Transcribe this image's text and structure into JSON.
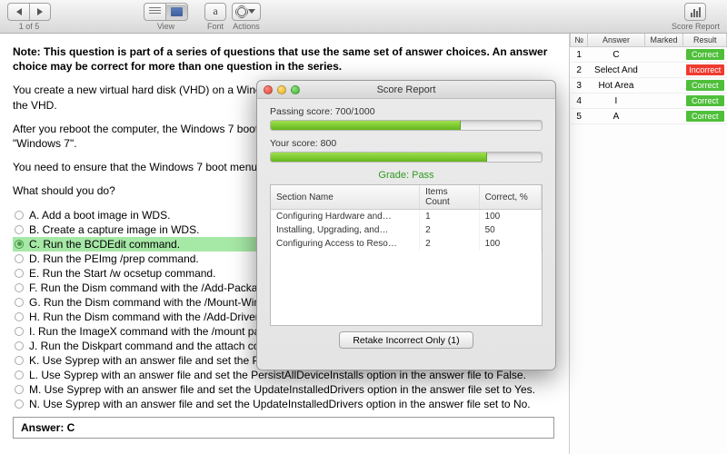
{
  "toolbar": {
    "nav_counter": "1 of 5",
    "view": "View",
    "font": "Font",
    "font_letter": "a",
    "actions": "Actions",
    "score_report": "Score Report"
  },
  "question": {
    "note": "Note: This question is part of a series of questions that use the same set of answer choices. An answer choice may be correct for more than one question in the series.",
    "para1": "You create a new virtual hard disk (VHD) on a Windows 7 Enterprise computer. Then you install Windows 7 on the VHD.",
    "para2": "After you reboot the computer, the Windows 7 boot menu shows two different Windows 7 installations titled \"Windows 7\".",
    "para3": "You need to ensure that the Windows 7 boot menu differentiates between the two Windows 7 installations.",
    "prompt": "What should you do?",
    "options": [
      "A. Add a boot image in WDS.",
      "B. Create a capture image in WDS.",
      "C. Run the BCDEdit command.",
      "D. Run the PEImg /prep command.",
      "E. Run the Start /w ocsetup command.",
      "F. Run the Dism command with the /Add-Package option.",
      "G. Run the Dism command with the /Mount-Wim option.",
      "H. Run the Dism command with the /Add-Driver option.",
      "I. Run the ImageX command with the /mount parameter.",
      "J. Run the Diskpart command and the attach command option.",
      "K. Use Syprep with an answer file and set the PersistAllDeviceInstalls option in the answer file to True.",
      "L. Use Syprep with an answer file and set the PersistAllDeviceInstalls option in the answer file to False.",
      "M. Use Syprep with an answer file and set the UpdateInstalledDrivers option in the answer file set to Yes.",
      "N. Use Syprep with an answer file and set the UpdateInstalledDrivers option in the answer file set to No."
    ],
    "selected_index": 2,
    "answer_label": "Answer: C"
  },
  "side": {
    "headers": {
      "n": "№",
      "answer": "Answer",
      "marked": "Marked",
      "result": "Result"
    },
    "rows": [
      {
        "n": "1",
        "answer": "C",
        "marked": "",
        "result": "Correct",
        "ok": true
      },
      {
        "n": "2",
        "answer": "Select And",
        "marked": "",
        "result": "Incorrect",
        "ok": false
      },
      {
        "n": "3",
        "answer": "Hot Area",
        "marked": "",
        "result": "Correct",
        "ok": true
      },
      {
        "n": "4",
        "answer": "I",
        "marked": "",
        "result": "Correct",
        "ok": true
      },
      {
        "n": "5",
        "answer": "A",
        "marked": "",
        "result": "Correct",
        "ok": true
      }
    ]
  },
  "modal": {
    "title": "Score Report",
    "passing_label": "Passing score: 700/1000",
    "passing_pct": 70,
    "your_label": "Your score: 800",
    "your_pct": 80,
    "grade": "Grade: Pass",
    "headers": {
      "section": "Section Name",
      "items": "Items Count",
      "correct": "Correct, %"
    },
    "sections": [
      {
        "name": "Configuring Hardware and…",
        "items": "1",
        "correct": "100"
      },
      {
        "name": "Installing, Upgrading, and…",
        "items": "2",
        "correct": "50"
      },
      {
        "name": "Configuring Access to Reso…",
        "items": "2",
        "correct": "100"
      }
    ],
    "retake": "Retake Incorrect Only (1)"
  }
}
